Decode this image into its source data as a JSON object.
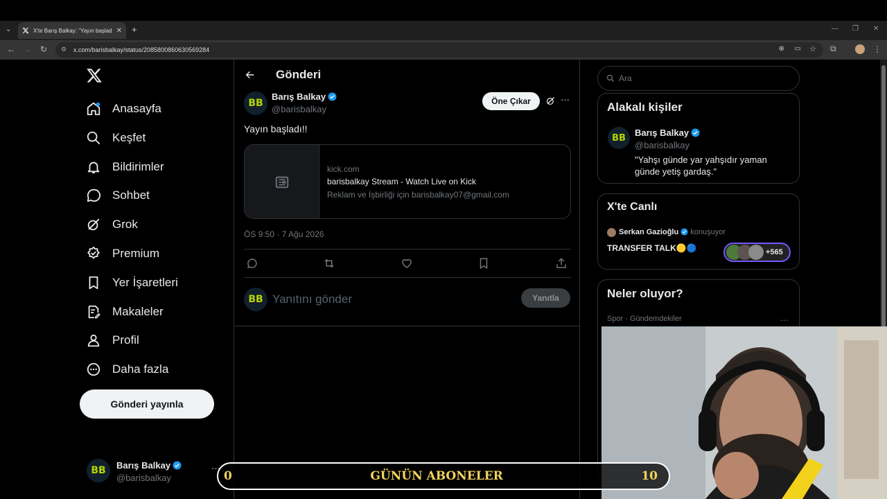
{
  "browser": {
    "tab_title": "X'te Barış Balkay: \"Yayın başladı!!\"",
    "tab_close": "✕",
    "new_tab": "+",
    "url": "x.com/barisbalkay/status/2085800860630569284"
  },
  "sidebar": {
    "items": [
      {
        "label": "Anasayfa",
        "icon": "home-icon"
      },
      {
        "label": "Keşfet",
        "icon": "search-icon"
      },
      {
        "label": "Bildirimler",
        "icon": "bell-icon"
      },
      {
        "label": "Sohbet",
        "icon": "chat-icon"
      },
      {
        "label": "Grok",
        "icon": "grok-icon"
      },
      {
        "label": "Premium",
        "icon": "premium-icon"
      },
      {
        "label": "Yer İşaretleri",
        "icon": "bookmark-icon"
      },
      {
        "label": "Makaleler",
        "icon": "article-icon"
      },
      {
        "label": "Profil",
        "icon": "profile-icon"
      },
      {
        "label": "Daha fazla",
        "icon": "more-circle-icon"
      }
    ],
    "post_button": "Gönderi yayınla",
    "account_name": "Barış Balkay",
    "account_handle": "@barisbalkay",
    "account_more": "···"
  },
  "post": {
    "header_title": "Gönderi",
    "author_name": "Barış Balkay",
    "author_handle": "@barisbalkay",
    "highlight_button": "Öne Çıkar",
    "text": "Yayın başladı!!",
    "card_domain": "kick.com",
    "card_title": "barisbalkay Stream - Watch Live on Kick",
    "card_desc": "Reklam ve İşbirliği için barisbalkay07@gmail.com",
    "timestamp": "ÖS 9:50 · 7 Ağu 2026",
    "reply_placeholder": "Yanıtını gönder",
    "reply_button": "Yanıtla"
  },
  "right": {
    "search_placeholder": "Ara",
    "relevant_title": "Alakalı kişiler",
    "relevant_name": "Barış Balkay",
    "relevant_handle": "@barisbalkay",
    "relevant_bio": "\"Yahşı günde yar yahşıdır yaman günde yetiş gardaş.\"",
    "live_title": "X'te Canlı",
    "live_host": "Serkan Gazioğlu",
    "live_status": "konuşuyor",
    "live_space_title": "TRANSFER TALK🟡🔵",
    "live_count": "+565",
    "trends_title": "Neler oluyor?",
    "trends_category": "Spor · Gündemdekiler",
    "trends_more": "···"
  },
  "overlay": {
    "left_number": "0",
    "banner_title": "GÜNÜN ABONELER",
    "right_number": "10"
  },
  "colors": {
    "verified": "#1d9bf0",
    "accent_text": "#e7e9ea",
    "muted": "#71767b",
    "banner_text": "#f4d35e",
    "avatar_logo": "#b5d400"
  }
}
